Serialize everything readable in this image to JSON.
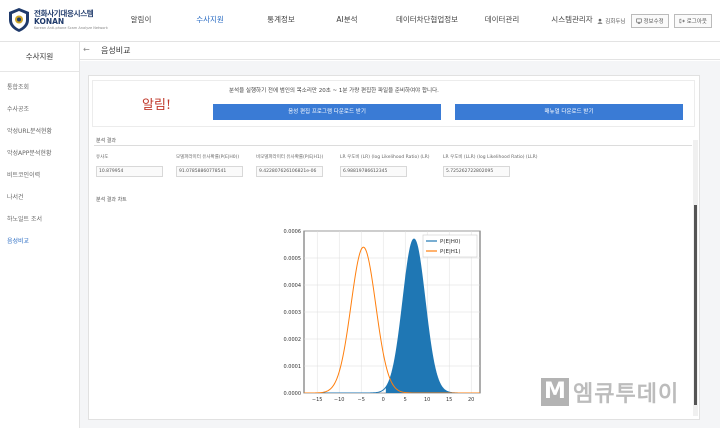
{
  "header": {
    "logo": {
      "title_ko": "전화사기대응시스템",
      "title_en": "KONAN",
      "subtitle": "Korean Anti-phone Scam Analyze Network"
    },
    "nav": [
      {
        "label": "알림이",
        "active": false
      },
      {
        "label": "수사지원",
        "active": true
      },
      {
        "label": "통계정보",
        "active": false
      },
      {
        "label": "AI분석",
        "active": false
      },
      {
        "label": "데이터차단협업정보",
        "active": false
      },
      {
        "label": "데이터관리",
        "active": false
      },
      {
        "label": "시스템관리자",
        "active": false
      }
    ],
    "user": {
      "name": "김회두님",
      "info_button": "정보수정",
      "logout_button": "로그아웃"
    }
  },
  "sidebar": {
    "title": "수사지원",
    "items": [
      {
        "label": "통합조회",
        "active": false
      },
      {
        "label": "수사공조",
        "active": false
      },
      {
        "label": "악성URL분석현황",
        "active": false
      },
      {
        "label": "악성APP분석현황",
        "active": false
      },
      {
        "label": "비트코인이력",
        "active": false
      },
      {
        "label": "나서건",
        "active": false
      },
      {
        "label": "하노일트 조서",
        "active": false
      },
      {
        "label": "음성비교",
        "active": true
      }
    ]
  },
  "page": {
    "title": "음성비교"
  },
  "alert": {
    "title": "알림!",
    "message": "분석을 실행하기 전에 범인의 목소리만 20초 ~ 1분 가량 편집한 파일을 준비하여야 합니다.",
    "button_1": "음성 편집 프로그램 다운로드 받기",
    "button_2": "매뉴얼 다운로드 받기"
  },
  "results": {
    "section_label": "분석 결과",
    "fields": [
      {
        "label": "유사도",
        "value": "10.879954"
      },
      {
        "label": "모델파라미터 유사확률(P(E|H0))",
        "value": "91.07858860778541"
      },
      {
        "label": "비모델파라미터 유사확률(P(E|H1))",
        "value": "9.422807626106821e-06"
      },
      {
        "label": "LR 우도비 (LR) (log Likelihood Ratio) (LR)",
        "value": "6.98819786612345"
      },
      {
        "label": "LR 우도비 (LLR) (log Likelihood Ratio) (LLR)",
        "value": "5.725262722802095"
      }
    ],
    "chart_section_label": "분석 결과 차트"
  },
  "chart_data": {
    "type": "area",
    "title": "",
    "xlabel": "",
    "ylabel": "",
    "xlim": [
      -18,
      22
    ],
    "ylim": [
      0,
      0.0006
    ],
    "xticks": [
      -15,
      -10,
      -5,
      0,
      5,
      10,
      15,
      20
    ],
    "ytick_labels": [
      "0.0000",
      "0.0001",
      "0.0002",
      "0.0003",
      "0.0004",
      "0.0005",
      "0.0006"
    ],
    "legend_position": "top-right",
    "series": [
      {
        "name": "P(E|H0)",
        "color": "#1f77b4",
        "mean": 7.0,
        "std": 2.5,
        "peak": 0.00057,
        "filled": true
      },
      {
        "name": "P(E|H1)",
        "color": "#ff7f0e",
        "mean": -4.5,
        "std": 2.8,
        "peak": 0.00054,
        "filled": false
      }
    ],
    "fill_right_of": 0.6
  },
  "watermark": {
    "letter": "M",
    "text": "엠큐투데이"
  }
}
